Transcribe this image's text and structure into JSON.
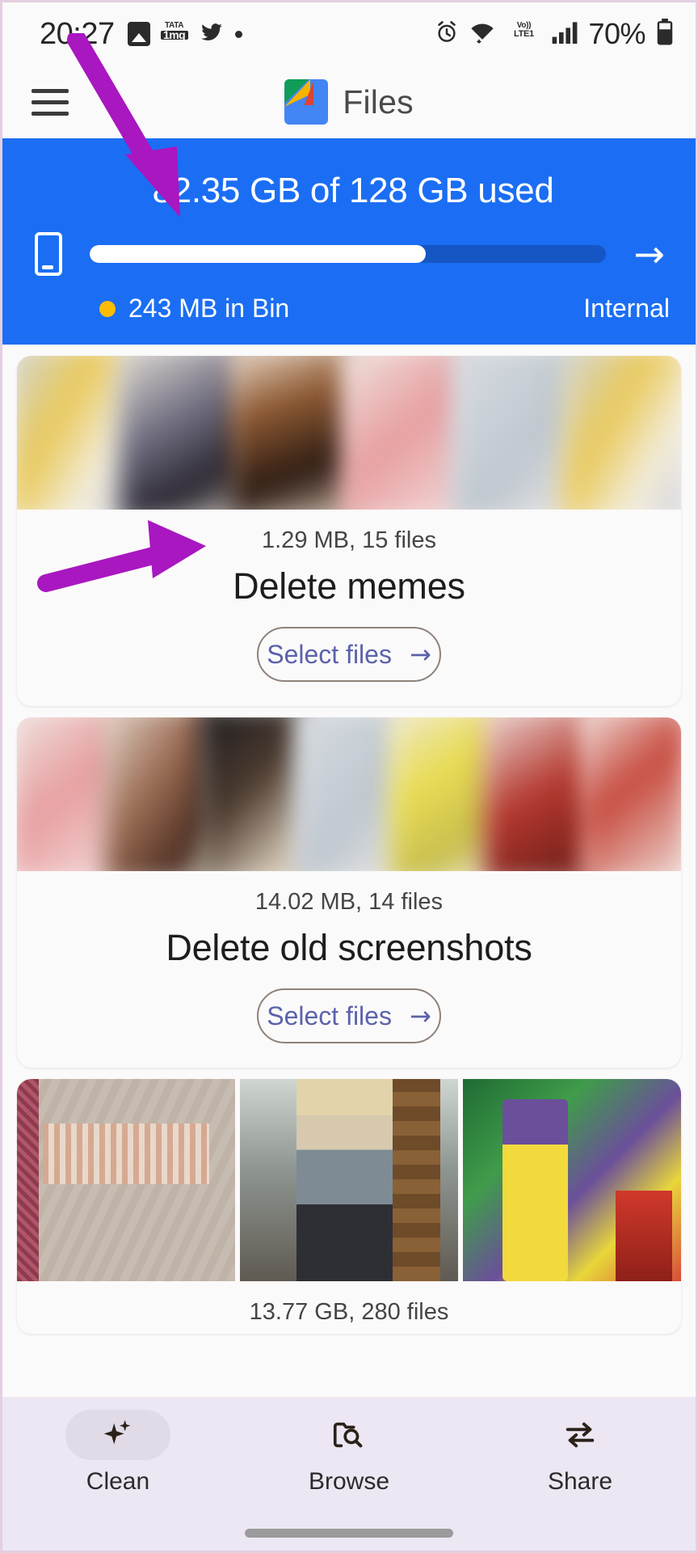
{
  "status_bar": {
    "time": "20:27",
    "left_icons": [
      "photo-icon",
      "tata-1mg-icon",
      "twitter-icon",
      "dot-icon"
    ],
    "tata_top": "TATA",
    "tata_bottom": "1mg",
    "volte_top": "Vo))",
    "volte_bottom": "LTE1",
    "battery_percent": "70%",
    "right_icons": [
      "alarm-icon",
      "wifi-icon",
      "volte-icon",
      "signal-icon",
      "battery-icon"
    ]
  },
  "app_bar": {
    "menu_icon": "hamburger-menu-icon",
    "logo": "files-app-logo",
    "title": "Files"
  },
  "storage": {
    "headline": "82.35 GB of 128 GB used",
    "used_gb": 82.35,
    "total_gb": 128,
    "fill_percent": 65,
    "bin_label": "243 MB in Bin",
    "bin_dot_color": "#fbbc04",
    "storage_label": "Internal",
    "banner_color": "#1b6ef3",
    "arrow_icon": "arrow-right-icon",
    "device_icon": "phone-icon"
  },
  "cards": [
    {
      "meta": "1.29 MB, 15 files",
      "title": "Delete memes",
      "button": "Select files",
      "button_arrow": "→",
      "thumbnail_type": "blurred-strip"
    },
    {
      "meta": "14.02 MB, 14 files",
      "title": "Delete old screenshots",
      "button": "Select files",
      "button_arrow": "→",
      "thumbnail_type": "blurred-strip"
    },
    {
      "meta": "13.77 GB, 280 files",
      "title": "",
      "button": "",
      "button_arrow": "",
      "thumbnail_type": "photo-row"
    }
  ],
  "bottom_nav": {
    "items": [
      {
        "label": "Clean",
        "icon": "sparkle-icon",
        "active": true
      },
      {
        "label": "Browse",
        "icon": "folder-search-icon",
        "active": false
      },
      {
        "label": "Share",
        "icon": "swap-arrows-icon",
        "active": false
      }
    ]
  },
  "annotations": {
    "color": "#a817c0",
    "arrows": [
      {
        "name": "arrow-to-storage-headline"
      },
      {
        "name": "arrow-to-select-files-button"
      }
    ]
  }
}
